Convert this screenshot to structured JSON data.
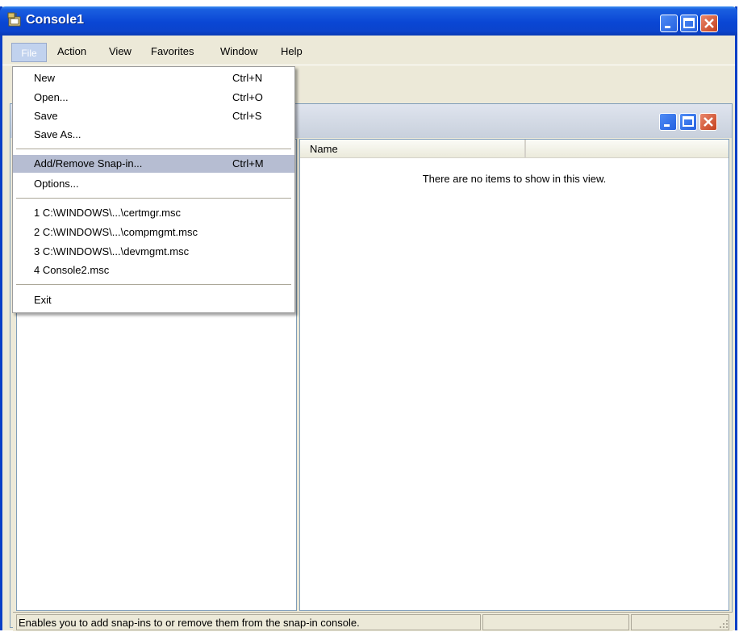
{
  "window": {
    "title": "Console1"
  },
  "menubar": {
    "items": [
      "File",
      "Action",
      "View",
      "Favorites",
      "Window",
      "Help"
    ]
  },
  "file_menu": {
    "group1": [
      {
        "label": "New",
        "shortcut": "Ctrl+N"
      },
      {
        "label": "Open...",
        "shortcut": "Ctrl+O"
      },
      {
        "label": "Save",
        "shortcut": "Ctrl+S"
      },
      {
        "label": "Save As...",
        "shortcut": ""
      }
    ],
    "group2": [
      {
        "label": "Add/Remove Snap-in...",
        "shortcut": "Ctrl+M",
        "highlighted": true
      },
      {
        "label": "Options...",
        "shortcut": ""
      }
    ],
    "recent": [
      "1 C:\\WINDOWS\\...\\certmgr.msc",
      "2 C:\\WINDOWS\\...\\compmgmt.msc",
      "3 C:\\WINDOWS\\...\\devmgmt.msc",
      "4 Console2.msc"
    ],
    "exit": "Exit"
  },
  "list_view": {
    "columns": [
      "Name"
    ],
    "empty_message": "There are no items to show in this view."
  },
  "status_bar": {
    "text": "Enables you to add snap-ins to or remove them from the snap-in console."
  },
  "icons": {
    "app": "console-icon",
    "minimize": "minimize-icon",
    "maximize": "maximize-icon",
    "close": "close-icon"
  },
  "colors": {
    "title_blue": "#0a46d4",
    "close_red": "#c4401e",
    "menu_highlight": "#b6bdd2",
    "chrome": "#ece9d8"
  }
}
